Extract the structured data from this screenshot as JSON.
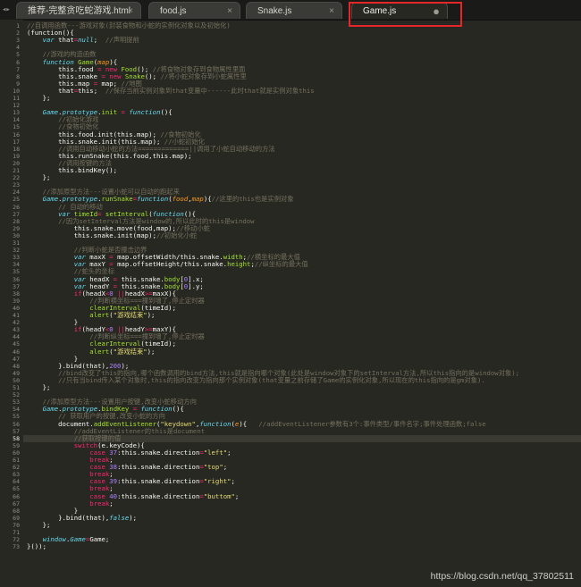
{
  "tabs": [
    {
      "label": "推荐-完整贪吃蛇游戏.html",
      "active": false
    },
    {
      "label": "food.js",
      "active": false
    },
    {
      "label": "Snake.js",
      "active": false
    },
    {
      "label": "Game.js",
      "active": true
    }
  ],
  "tab_close_glyph": "×",
  "active_tab_dot": "●",
  "nav_arrows": "◂▸",
  "current_line": 58,
  "watermark": "https://blog.csdn.net/qq_37802511",
  "code": [
    [
      [
        "c",
        "//自调用函数---游戏对象(封装食物和小蛇的实例化对象以及初始化)"
      ]
    ],
    [
      [
        "t",
        "(function(){"
      ]
    ],
    [
      [
        "t",
        "    "
      ],
      [
        "s",
        "var"
      ],
      [
        "t",
        " that"
      ],
      [
        "k",
        "="
      ],
      [
        "s",
        "null"
      ],
      [
        "t",
        ";  "
      ],
      [
        "c",
        "//声明提前"
      ]
    ],
    [
      [
        "t",
        ""
      ]
    ],
    [
      [
        "t",
        "    "
      ],
      [
        "c",
        "//游戏的构造函数"
      ]
    ],
    [
      [
        "t",
        "    "
      ],
      [
        "s",
        "function"
      ],
      [
        "t",
        " "
      ],
      [
        "f",
        "Game"
      ],
      [
        "t",
        "("
      ],
      [
        "p",
        "map"
      ],
      [
        "t",
        "){"
      ]
    ],
    [
      [
        "t",
        "        this.food "
      ],
      [
        "k",
        "="
      ],
      [
        "t",
        " "
      ],
      [
        "k",
        "new"
      ],
      [
        "t",
        " "
      ],
      [
        "f",
        "Food"
      ],
      [
        "t",
        "(); "
      ],
      [
        "c",
        "//将食物对象存到食物属性里面"
      ]
    ],
    [
      [
        "t",
        "        this.snake "
      ],
      [
        "k",
        "="
      ],
      [
        "t",
        " "
      ],
      [
        "k",
        "new"
      ],
      [
        "t",
        " "
      ],
      [
        "f",
        "Snake"
      ],
      [
        "t",
        "(); "
      ],
      [
        "c",
        "//将小蛇对象存到小蛇属性里"
      ]
    ],
    [
      [
        "t",
        "        this.map "
      ],
      [
        "k",
        "="
      ],
      [
        "t",
        " map; "
      ],
      [
        "c",
        "//地图"
      ]
    ],
    [
      [
        "t",
        "        that"
      ],
      [
        "k",
        "="
      ],
      [
        "t",
        "this;  "
      ],
      [
        "c",
        "//保存当前实例对象到that变量中------此时that就是实例对象this"
      ]
    ],
    [
      [
        "t",
        "    };"
      ]
    ],
    [
      [
        "t",
        ""
      ]
    ],
    [
      [
        "t",
        "    "
      ],
      [
        "s",
        "Game"
      ],
      [
        "t",
        "."
      ],
      [
        "s",
        "prototype"
      ],
      [
        "t",
        "."
      ],
      [
        "f",
        "init"
      ],
      [
        "t",
        " "
      ],
      [
        "k",
        "="
      ],
      [
        "t",
        " "
      ],
      [
        "s",
        "function"
      ],
      [
        "t",
        "(){"
      ]
    ],
    [
      [
        "t",
        "        "
      ],
      [
        "c",
        "//初始化游戏"
      ]
    ],
    [
      [
        "t",
        "        "
      ],
      [
        "c",
        "//食物初始化"
      ]
    ],
    [
      [
        "t",
        "        this.food.init(this.map); "
      ],
      [
        "c",
        "//食物初始化"
      ]
    ],
    [
      [
        "t",
        "        this.snake.init(this.map); "
      ],
      [
        "c",
        "//小蛇初始化"
      ]
    ],
    [
      [
        "t",
        "        "
      ],
      [
        "c",
        "//调用自动移动小蛇的方法=============||调用了小蛇自动移动的方法"
      ]
    ],
    [
      [
        "t",
        "        this.runSnake(this.food,this.map);"
      ]
    ],
    [
      [
        "t",
        "        "
      ],
      [
        "c",
        "//调用按键的方法"
      ]
    ],
    [
      [
        "t",
        "        this.bindKey();"
      ]
    ],
    [
      [
        "t",
        "    };"
      ]
    ],
    [
      [
        "t",
        ""
      ]
    ],
    [
      [
        "t",
        "    "
      ],
      [
        "c",
        "//添加原型方法---设置小蛇可以自动的跑起来"
      ]
    ],
    [
      [
        "t",
        "    "
      ],
      [
        "s",
        "Game"
      ],
      [
        "t",
        "."
      ],
      [
        "s",
        "prototype"
      ],
      [
        "t",
        "."
      ],
      [
        "f",
        "runSnake"
      ],
      [
        "k",
        "="
      ],
      [
        "s",
        "function"
      ],
      [
        "t",
        "("
      ],
      [
        "p",
        "food"
      ],
      [
        "t",
        ","
      ],
      [
        "p",
        "map"
      ],
      [
        "t",
        "){"
      ],
      [
        "c",
        "//这里的this也是实例对象"
      ]
    ],
    [
      [
        "t",
        "        "
      ],
      [
        "c",
        "// 自动的移动"
      ]
    ],
    [
      [
        "t",
        "        "
      ],
      [
        "s",
        "var"
      ],
      [
        "t",
        " "
      ],
      [
        "f",
        "timeId"
      ],
      [
        "k",
        "="
      ],
      [
        "t",
        " "
      ],
      [
        "f",
        "setInterval"
      ],
      [
        "t",
        "("
      ],
      [
        "s",
        "function"
      ],
      [
        "t",
        "(){"
      ]
    ],
    [
      [
        "t",
        "        "
      ],
      [
        "c",
        "//因为setInterval方法是window的,所以此时的this是window"
      ]
    ],
    [
      [
        "t",
        "            this.snake.move(food,map);"
      ],
      [
        "c",
        "//移动小蛇"
      ]
    ],
    [
      [
        "t",
        "            this.snake.init(map);"
      ],
      [
        "c",
        "//初始化小蛇"
      ]
    ],
    [
      [
        "t",
        ""
      ]
    ],
    [
      [
        "t",
        "            "
      ],
      [
        "c",
        "//判断小蛇是否撞击边界"
      ]
    ],
    [
      [
        "t",
        "            "
      ],
      [
        "s",
        "var"
      ],
      [
        "t",
        " maxX "
      ],
      [
        "k",
        "="
      ],
      [
        "t",
        " map.offsetWidth/this.snake."
      ],
      [
        "f",
        "width"
      ],
      [
        "t",
        ";"
      ],
      [
        "c",
        "//横坐标的最大值"
      ]
    ],
    [
      [
        "t",
        "            "
      ],
      [
        "s",
        "var"
      ],
      [
        "t",
        " maxY "
      ],
      [
        "k",
        "="
      ],
      [
        "t",
        " map.offsetHeight/this.snake."
      ],
      [
        "f",
        "height"
      ],
      [
        "t",
        ";"
      ],
      [
        "c",
        "//纵坐标的最大值"
      ]
    ],
    [
      [
        "t",
        "            "
      ],
      [
        "c",
        "//蛇头的坐标"
      ]
    ],
    [
      [
        "t",
        "            "
      ],
      [
        "s",
        "var"
      ],
      [
        "t",
        " headX "
      ],
      [
        "k",
        "="
      ],
      [
        "t",
        " this.snake."
      ],
      [
        "f",
        "body"
      ],
      [
        "t",
        "["
      ],
      [
        "n",
        "0"
      ],
      [
        "t",
        "].x;"
      ]
    ],
    [
      [
        "t",
        "            "
      ],
      [
        "s",
        "var"
      ],
      [
        "t",
        " headY "
      ],
      [
        "k",
        "="
      ],
      [
        "t",
        " this.snake."
      ],
      [
        "f",
        "body"
      ],
      [
        "t",
        "["
      ],
      [
        "n",
        "0"
      ],
      [
        "t",
        "].y;"
      ]
    ],
    [
      [
        "t",
        "            "
      ],
      [
        "k",
        "if"
      ],
      [
        "t",
        "(headX"
      ],
      [
        "k",
        "<"
      ],
      [
        "n",
        "0"
      ],
      [
        "t",
        " "
      ],
      [
        "k",
        "||"
      ],
      [
        "t",
        "headX"
      ],
      [
        "k",
        ">="
      ],
      [
        "t",
        "maxX){"
      ]
    ],
    [
      [
        "t",
        "                "
      ],
      [
        "c",
        "//判断横坐标===撞到墙了,停止定时器"
      ]
    ],
    [
      [
        "t",
        "                "
      ],
      [
        "f",
        "clearInterval"
      ],
      [
        "t",
        "(timeId);"
      ]
    ],
    [
      [
        "t",
        "                "
      ],
      [
        "f",
        "alert"
      ],
      [
        "t",
        "("
      ],
      [
        "str",
        "\"游戏结束\""
      ],
      [
        "t",
        ");"
      ]
    ],
    [
      [
        "t",
        "            }"
      ]
    ],
    [
      [
        "t",
        "            "
      ],
      [
        "k",
        "if"
      ],
      [
        "t",
        "(headY"
      ],
      [
        "k",
        "<"
      ],
      [
        "n",
        "0"
      ],
      [
        "t",
        " "
      ],
      [
        "k",
        "||"
      ],
      [
        "t",
        "headY"
      ],
      [
        "k",
        ">="
      ],
      [
        "t",
        "maxY){"
      ]
    ],
    [
      [
        "t",
        "                "
      ],
      [
        "c",
        "//判断纵坐标===撞到墙了,停止定时器"
      ]
    ],
    [
      [
        "t",
        "                "
      ],
      [
        "f",
        "clearInterval"
      ],
      [
        "t",
        "(timeId);"
      ]
    ],
    [
      [
        "t",
        "                "
      ],
      [
        "f",
        "alert"
      ],
      [
        "t",
        "("
      ],
      [
        "str",
        "\"游戏结束\""
      ],
      [
        "t",
        ");"
      ]
    ],
    [
      [
        "t",
        "            }"
      ]
    ],
    [
      [
        "t",
        "        }.bind(that),"
      ],
      [
        "n",
        "200"
      ],
      [
        "t",
        ");"
      ]
    ],
    [
      [
        "t",
        "        "
      ],
      [
        "c",
        "//bind改变了this的指向,哪个函数调用的bind方法,this就是指向哪个对象(此处是window对象下的setInterval方法,所以this指向的是window对象);"
      ]
    ],
    [
      [
        "t",
        "        "
      ],
      [
        "c",
        "//只有当bind传入某个对象时,this的指向改变为指向那个实例对象(that变量之前存储了Game的实例化对象,所以现在的this指向的是gm对象)."
      ]
    ],
    [
      [
        "t",
        "    };"
      ]
    ],
    [
      [
        "t",
        ""
      ]
    ],
    [
      [
        "t",
        "    "
      ],
      [
        "c",
        "//添加原型方法---设置用户按键,改变小蛇移动方向"
      ]
    ],
    [
      [
        "t",
        "    "
      ],
      [
        "s",
        "Game"
      ],
      [
        "t",
        "."
      ],
      [
        "s",
        "prototype"
      ],
      [
        "t",
        "."
      ],
      [
        "f",
        "bindKey"
      ],
      [
        "t",
        " "
      ],
      [
        "k",
        "="
      ],
      [
        "t",
        " "
      ],
      [
        "s",
        "function"
      ],
      [
        "t",
        "(){"
      ]
    ],
    [
      [
        "t",
        "        "
      ],
      [
        "c",
        "// 获取用户的按键,改变小蛇的方向"
      ]
    ],
    [
      [
        "t",
        "        document."
      ],
      [
        "f",
        "addEventListener"
      ],
      [
        "t",
        "("
      ],
      [
        "str",
        "\"keydown\""
      ],
      [
        "t",
        ","
      ],
      [
        "s",
        "function"
      ],
      [
        "t",
        "("
      ],
      [
        "p",
        "e"
      ],
      [
        "t",
        "){   "
      ],
      [
        "c",
        "//addEventListener参数有3个:事件类型/事件名字;事件处理函数;false"
      ]
    ],
    [
      [
        "t",
        "            "
      ],
      [
        "c",
        "//addEventListener的this是document"
      ]
    ],
    [
      [
        "t",
        "            "
      ],
      [
        "c",
        "//获取按键的值"
      ]
    ],
    [
      [
        "t",
        "            "
      ],
      [
        "k",
        "switch"
      ],
      [
        "t",
        "(e.keyCode){"
      ]
    ],
    [
      [
        "t",
        "                "
      ],
      [
        "k",
        "case"
      ],
      [
        "t",
        " "
      ],
      [
        "n",
        "37"
      ],
      [
        "t",
        ":this.snake.direction"
      ],
      [
        "k",
        "="
      ],
      [
        "str",
        "\"left\""
      ],
      [
        "t",
        ";"
      ]
    ],
    [
      [
        "t",
        "                "
      ],
      [
        "k",
        "break"
      ],
      [
        "t",
        ";"
      ]
    ],
    [
      [
        "t",
        "                "
      ],
      [
        "k",
        "case"
      ],
      [
        "t",
        " "
      ],
      [
        "n",
        "38"
      ],
      [
        "t",
        ":this.snake.direction"
      ],
      [
        "k",
        "="
      ],
      [
        "str",
        "\"top\""
      ],
      [
        "t",
        ";"
      ]
    ],
    [
      [
        "t",
        "                "
      ],
      [
        "k",
        "break"
      ],
      [
        "t",
        ";"
      ]
    ],
    [
      [
        "t",
        "                "
      ],
      [
        "k",
        "case"
      ],
      [
        "t",
        " "
      ],
      [
        "n",
        "39"
      ],
      [
        "t",
        ":this.snake.direction"
      ],
      [
        "k",
        "="
      ],
      [
        "str",
        "\"right\""
      ],
      [
        "t",
        ";"
      ]
    ],
    [
      [
        "t",
        "                "
      ],
      [
        "k",
        "break"
      ],
      [
        "t",
        ";"
      ]
    ],
    [
      [
        "t",
        "                "
      ],
      [
        "k",
        "case"
      ],
      [
        "t",
        " "
      ],
      [
        "n",
        "40"
      ],
      [
        "t",
        ":this.snake.direction"
      ],
      [
        "k",
        "="
      ],
      [
        "str",
        "\"buttom\""
      ],
      [
        "t",
        ";"
      ]
    ],
    [
      [
        "t",
        "                "
      ],
      [
        "k",
        "break"
      ],
      [
        "t",
        ";"
      ]
    ],
    [
      [
        "t",
        "            }"
      ]
    ],
    [
      [
        "t",
        "        }.bind(that),"
      ],
      [
        "s",
        "false"
      ],
      [
        "t",
        ");"
      ]
    ],
    [
      [
        "t",
        "    };"
      ]
    ],
    [
      [
        "t",
        ""
      ]
    ],
    [
      [
        "t",
        "    "
      ],
      [
        "s",
        "window"
      ],
      [
        "t",
        "."
      ],
      [
        "s",
        "Game"
      ],
      [
        "k",
        "="
      ],
      [
        "t",
        "Game;"
      ]
    ],
    [
      [
        "t",
        "}());"
      ]
    ]
  ]
}
